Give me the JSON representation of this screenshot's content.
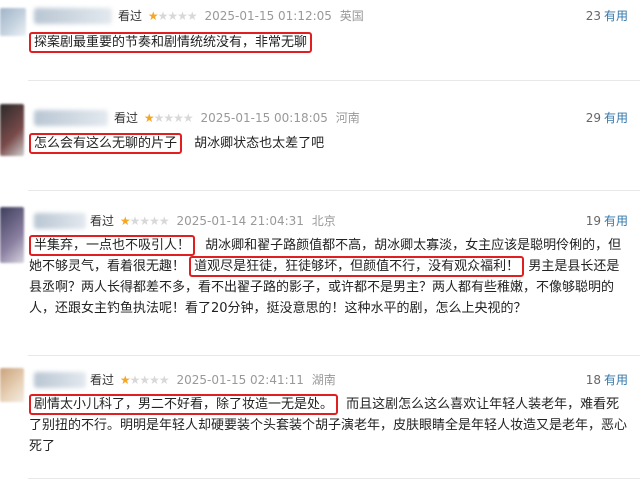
{
  "reviews": [
    {
      "watched": "看过",
      "rating": 1,
      "time": "2025-01-15 01:12:05",
      "location": "英国",
      "votes": "23",
      "useful": "有用",
      "highlight": "探案剧最重要的节奏和剧情统统没有，非常无聊",
      "text": ""
    },
    {
      "watched": "看过",
      "rating": 1,
      "time": "2025-01-15 00:18:05",
      "location": "河南",
      "votes": "29",
      "useful": "有用",
      "highlight": "怎么会有这么无聊的片子",
      "text": "胡冰卿状态也太差了吧"
    },
    {
      "watched": "看过",
      "rating": 1,
      "time": "2025-01-14 21:04:31",
      "location": "北京",
      "votes": "19",
      "useful": "有用",
      "highlight": "半集弃，一点也不吸引人！",
      "text_a": "胡冰卿和翟子路颜值都不高，胡冰卿太寡淡，女主应该是聪明伶俐的，但她不够灵气，看着很无趣！",
      "highlight2": "道观尽是狂徒，狂徒够坏，但颜值不行，没有观众福利！",
      "text_b": "男主是县长还是县丞啊？两人长得都差不多，看不出翟子路的影子，或许都不是男主？两人都有些稚嫩，不像够聪明的人，还跟女主钓鱼执法呢！看了20分钟，挺没意思的！这种水平的剧，怎么上央视的？"
    },
    {
      "watched": "看过",
      "rating": 1,
      "time": "2025-01-15 02:41:11",
      "location": "湖南",
      "votes": "18",
      "useful": "有用",
      "highlight": "剧情太小儿科了，男二不好看，除了妆造一无是处。",
      "text": "而且这剧怎么这么喜欢让年轻人装老年，难看死了别扭的不行。明明是年轻人却硬要装个头套装个胡子演老年，皮肤眼睛全是年轻人妆造又是老年，恶心死了"
    }
  ],
  "colors": {
    "highlight_border": "#e02020",
    "star": "#f5a623",
    "useful_link": "#3377aa"
  }
}
